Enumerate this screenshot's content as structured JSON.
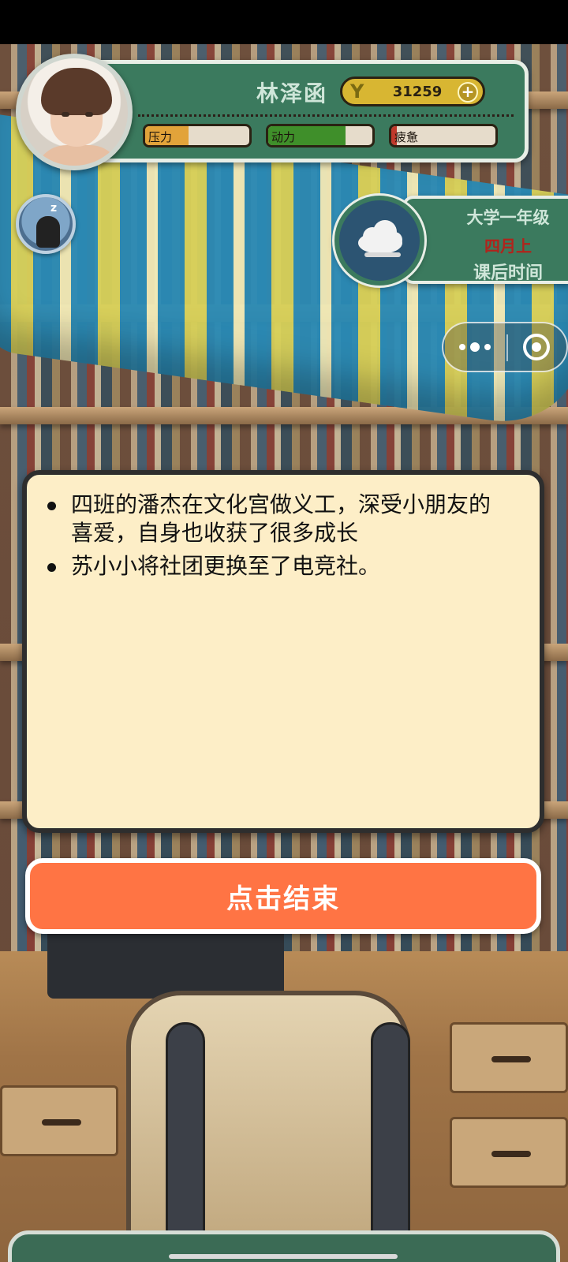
{
  "player": {
    "name": "林泽函",
    "coin_symbol": "Y",
    "coins": "31259",
    "coin_add": "+"
  },
  "stats": [
    {
      "label": "压力",
      "fill_fraction": 0.42,
      "color": "#e2a33a"
    },
    {
      "label": "动力",
      "fill_fraction": 0.74,
      "color": "#3f8f2a"
    },
    {
      "label": "疲惫",
      "fill_fraction": 0.05,
      "color": "#c0392b"
    }
  ],
  "time": {
    "grade": "大学一年级",
    "month": "四月上",
    "period": "课后时间",
    "weather_icon": "cloudy-icon"
  },
  "capsule": {
    "more_icon": "more-dots-icon",
    "close_icon": "target-circle-icon"
  },
  "messages": [
    "四班的潘杰在文化宫做义工，深受小朋友的喜爱，自身也收获了很多成长",
    "苏小小将社团更换至了电竞社。"
  ],
  "end_button": {
    "label": "点击结束",
    "color": "#ff7444"
  }
}
